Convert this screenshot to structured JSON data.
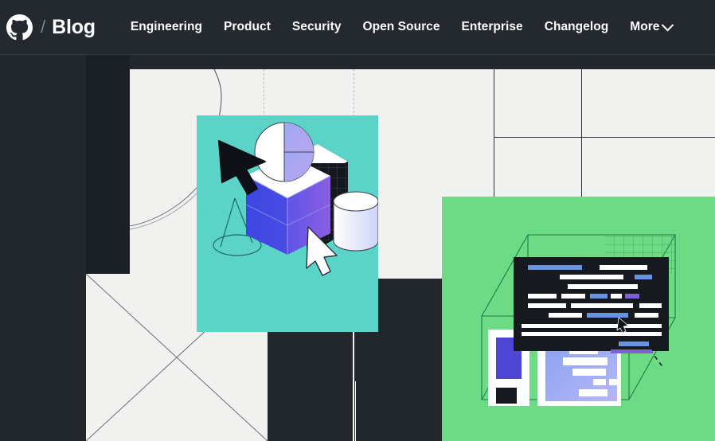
{
  "header": {
    "logo_icon": "github-mark-icon",
    "separator": "/",
    "title": "Blog",
    "nav": [
      {
        "label": "Engineering",
        "name": "nav-engineering"
      },
      {
        "label": "Product",
        "name": "nav-product"
      },
      {
        "label": "Security",
        "name": "nav-security"
      },
      {
        "label": "Open Source",
        "name": "nav-open-source"
      },
      {
        "label": "Enterprise",
        "name": "nav-enterprise"
      },
      {
        "label": "Changelog",
        "name": "nav-changelog"
      },
      {
        "label": "More",
        "name": "nav-more",
        "has_chevron": true
      }
    ]
  },
  "hero": {
    "cards": [
      {
        "name": "teal-illustration-card",
        "background": "#5cd3c7",
        "motifs": [
          "cursor-arrow",
          "pie-sphere",
          "gradient-cube",
          "grid-cube",
          "cylinder",
          "cone-outline",
          "white-cursor-arrow"
        ]
      },
      {
        "name": "green-illustration-card",
        "background": "#6dda86",
        "motifs": [
          "code-editor-panel",
          "wireframe-cube",
          "ui-panel-left",
          "ui-panel-right",
          "dashed-diagonal",
          "cursor-arrow"
        ]
      }
    ],
    "placeholder": {
      "name": "image-placeholder-box",
      "background": "#f1f1f0",
      "pattern": "x-cross"
    },
    "colors": {
      "page_background": "#22272e",
      "header_background": "#24292f",
      "paper": "#f1f1f0",
      "dark_strip": "#1b2026",
      "teal": "#5cd3c7",
      "green": "#6dda86",
      "code_panel": "#16191d",
      "accent_blue": "#6793e0",
      "accent_purple": "#7b61d9",
      "accent_indigo": "#4f46d6",
      "periwinkle": "#a7aef4"
    }
  }
}
